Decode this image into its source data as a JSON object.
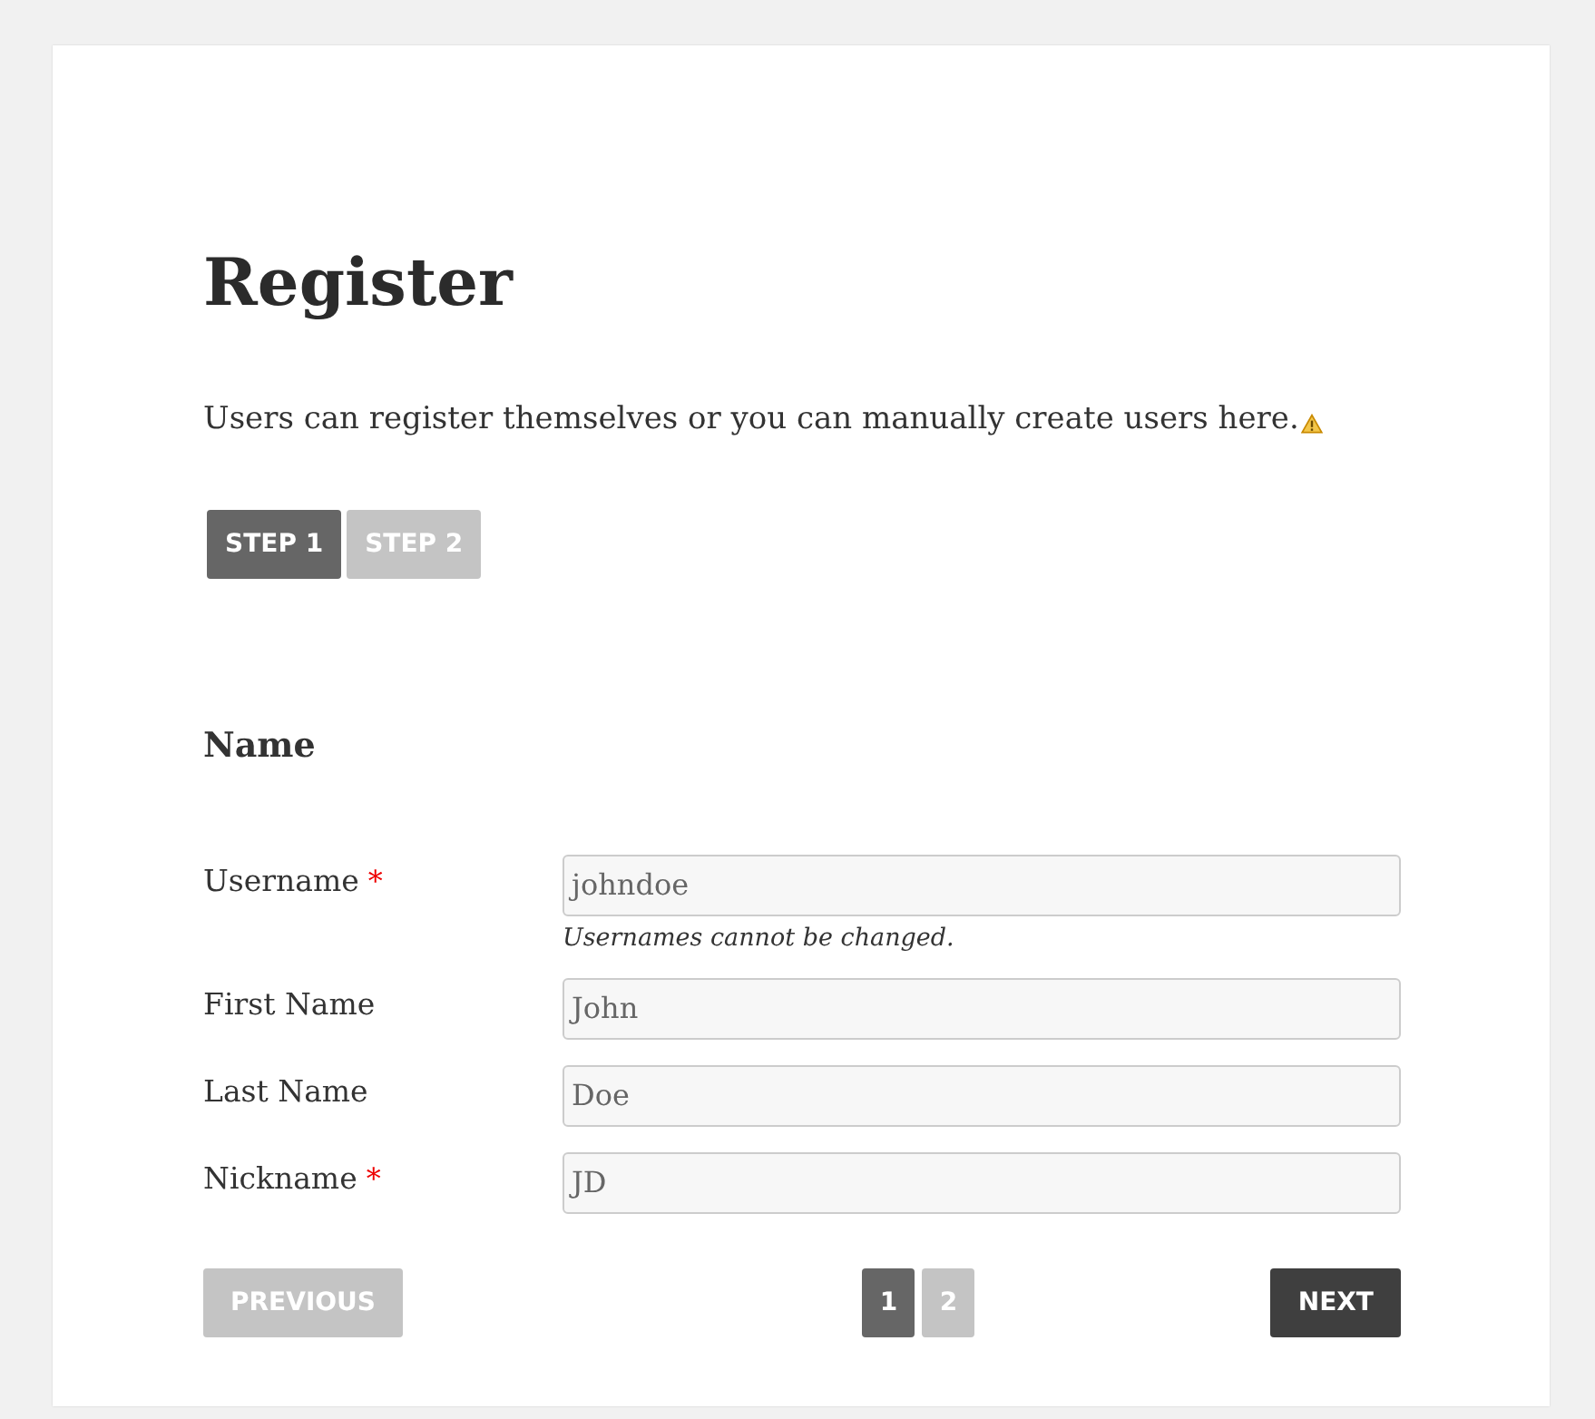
{
  "title": "Register",
  "intro": "Users can register themselves or you can manually create users here.",
  "steps": [
    {
      "label": "STEP 1",
      "selected": true
    },
    {
      "label": "STEP 2",
      "selected": false
    }
  ],
  "section": "Name",
  "fields": [
    {
      "label": "Username",
      "required": true,
      "value": "johndoe",
      "help": "Usernames cannot be changed."
    },
    {
      "label": "First Name",
      "required": false,
      "value": "John"
    },
    {
      "label": "Last Name",
      "required": false,
      "value": "Doe"
    },
    {
      "label": "Nickname",
      "required": true,
      "value": "JD"
    }
  ],
  "required_mark": "*",
  "previous": {
    "label": "PREVIOUS",
    "disabled": true
  },
  "pages": [
    {
      "label": "1",
      "selected": true
    },
    {
      "label": "2",
      "selected": false
    }
  ],
  "next": {
    "label": "NEXT",
    "disabled": false
  }
}
